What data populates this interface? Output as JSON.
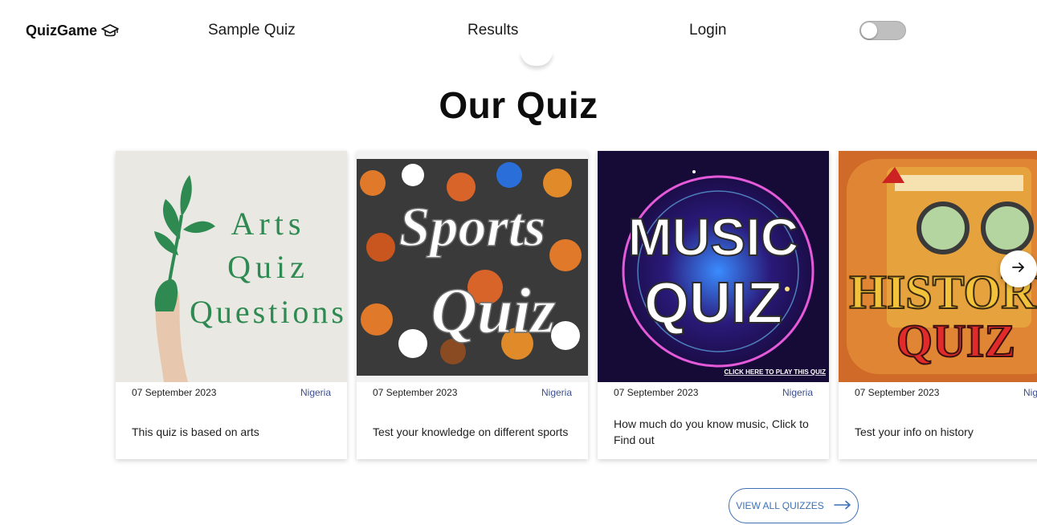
{
  "brand": {
    "name": "QuizGame",
    "icon": "graduation-cap-icon"
  },
  "nav": [
    {
      "label": "Sample Quiz"
    },
    {
      "label": "Results"
    },
    {
      "label": "Login"
    }
  ],
  "theme_toggle": {
    "state": "off"
  },
  "section": {
    "title": "Our Quiz"
  },
  "cards": [
    {
      "image_alt": "Arts Quiz Questions",
      "image_lines": [
        "Arts",
        "Quiz",
        "Questions"
      ],
      "date": "07 September 2023",
      "location": "Nigeria",
      "description": "This quiz is based on arts"
    },
    {
      "image_alt": "Sports Quiz",
      "image_lines": [
        "Sports",
        "Quiz"
      ],
      "date": "07 September 2023",
      "location": "Nigeria",
      "description": "Test your knowledge on different sports"
    },
    {
      "image_alt": "Music Quiz",
      "image_lines": [
        "MUSIC",
        "QUIZ",
        "CLICK HERE TO PLAY THIS QUIZ"
      ],
      "date": "07 September 2023",
      "location": "Nigeria",
      "description": "How much do you know music, Click to Find out"
    },
    {
      "image_alt": "History Quiz",
      "image_lines": [
        "HISTORY",
        "QUIZ"
      ],
      "date": "07 September 2023",
      "location": "Nigeria",
      "description": "Test your info on history"
    }
  ],
  "carousel": {
    "next_icon": "arrow-right-icon"
  },
  "view_all": {
    "label": "VIEW ALL QUIZZES",
    "icon": "long-arrow-right-icon"
  },
  "colors": {
    "accent": "#3d6fb5",
    "location": "#3c4f8f",
    "toggle": "#bfbfbf"
  }
}
